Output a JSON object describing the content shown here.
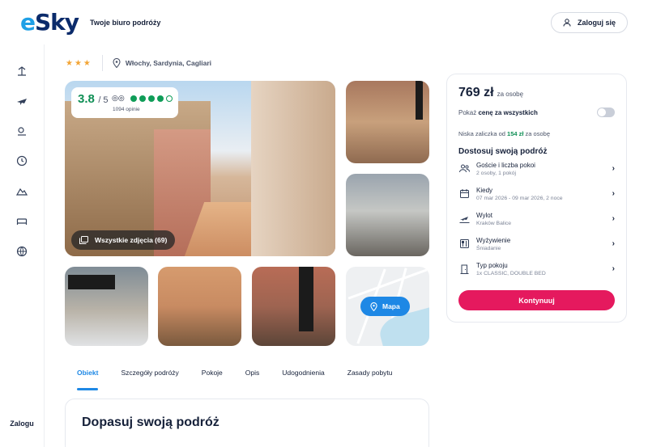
{
  "header": {
    "logo": "eSky",
    "tagline": "Twoje biuro podróży",
    "login_label": "Zaloguj się"
  },
  "rail": {
    "icons": [
      "beach-icon",
      "plane-icon",
      "sun-icon",
      "clock-icon",
      "mountain-icon",
      "bed-icon",
      "globe-icon"
    ],
    "login_label": "Zalogu"
  },
  "hotel": {
    "stars": "★★★",
    "location": "Włochy, Sardynia, Cagliari",
    "rating": {
      "score": "3.8",
      "max": "/ 5",
      "count": "1094 opinie",
      "dots_filled": 4,
      "dots_total": 5
    },
    "all_photos_label": "Wszystkie zdjęcia (69)",
    "map_label": "Mapa"
  },
  "tabs": [
    {
      "label": "Obiekt",
      "active": true
    },
    {
      "label": "Szczegóły podróży",
      "active": false
    },
    {
      "label": "Pokoje",
      "active": false
    },
    {
      "label": "Opis",
      "active": false
    },
    {
      "label": "Udogodnienia",
      "active": false
    },
    {
      "label": "Zasady pobytu",
      "active": false
    }
  ],
  "section": {
    "title": "Dopasuj swoją podróż"
  },
  "booking": {
    "price": "769 zł",
    "price_per": "za osobę",
    "toggle_prefix": "Pokaż ",
    "toggle_bold": "cenę za wszystkich",
    "deposit_prefix": "Niska zaliczka od ",
    "deposit_amount": "154 zł",
    "deposit_suffix": " za osobę",
    "customize_title": "Dostosuj swoją podróż",
    "options": [
      {
        "icon": "users-icon",
        "title": "Goście i liczba pokoi",
        "sub": "2 osoby, 1 pokój"
      },
      {
        "icon": "calendar-icon",
        "title": "Kiedy",
        "sub": "07 mar 2026 - 09 mar 2026, 2 noce"
      },
      {
        "icon": "plane-departure-icon",
        "title": "Wylot",
        "sub": "Kraków Balice"
      },
      {
        "icon": "cutlery-icon",
        "title": "Wyżywienie",
        "sub": "Śniadanie"
      },
      {
        "icon": "door-icon",
        "title": "Typ pokoju",
        "sub": "1x CLASSIC, DOUBLE BED"
      }
    ],
    "cta_label": "Kontynuuj"
  }
}
